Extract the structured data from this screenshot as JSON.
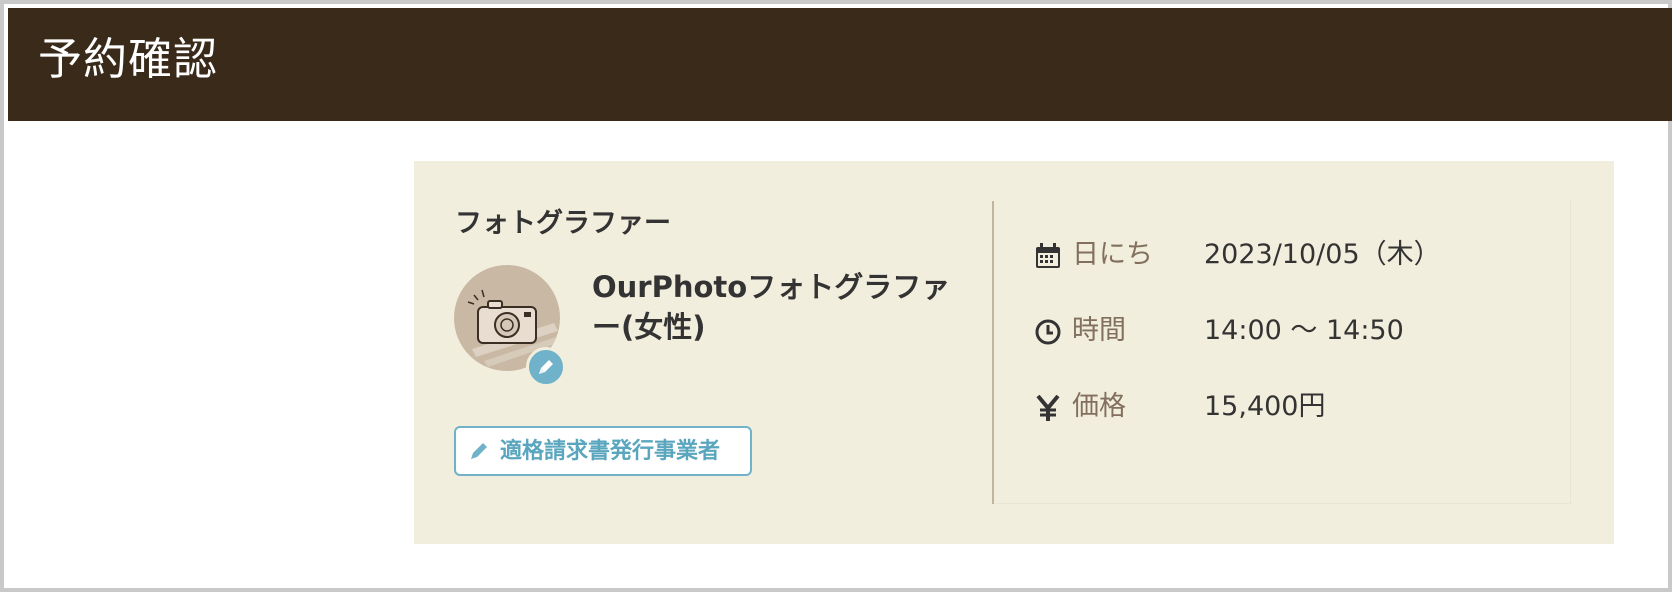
{
  "header": {
    "title": "予約確認"
  },
  "photographer": {
    "section_label": "フォトグラファー",
    "name": "OurPhotoフォトグラファー(女性)",
    "avatar_icon": "camera-icon",
    "badge_icon": "pen-icon",
    "invoice_badge_label": "適格請求書発行事業者",
    "invoice_badge_icon": "pen-icon"
  },
  "details": [
    {
      "icon": "calendar-icon",
      "label": "日にち",
      "value": "2023/10/05（木）"
    },
    {
      "icon": "clock-icon",
      "label": "時間",
      "value": "14:00 〜 14:50"
    },
    {
      "icon": "yen-icon",
      "label": "価格",
      "value": "15,400円"
    }
  ],
  "colors": {
    "header_bg": "#392a1a",
    "card_bg": "#f2eedd",
    "accent": "#6fb2c9",
    "label_brown": "#826f5d",
    "avatar_bg": "#c9b8a3"
  }
}
